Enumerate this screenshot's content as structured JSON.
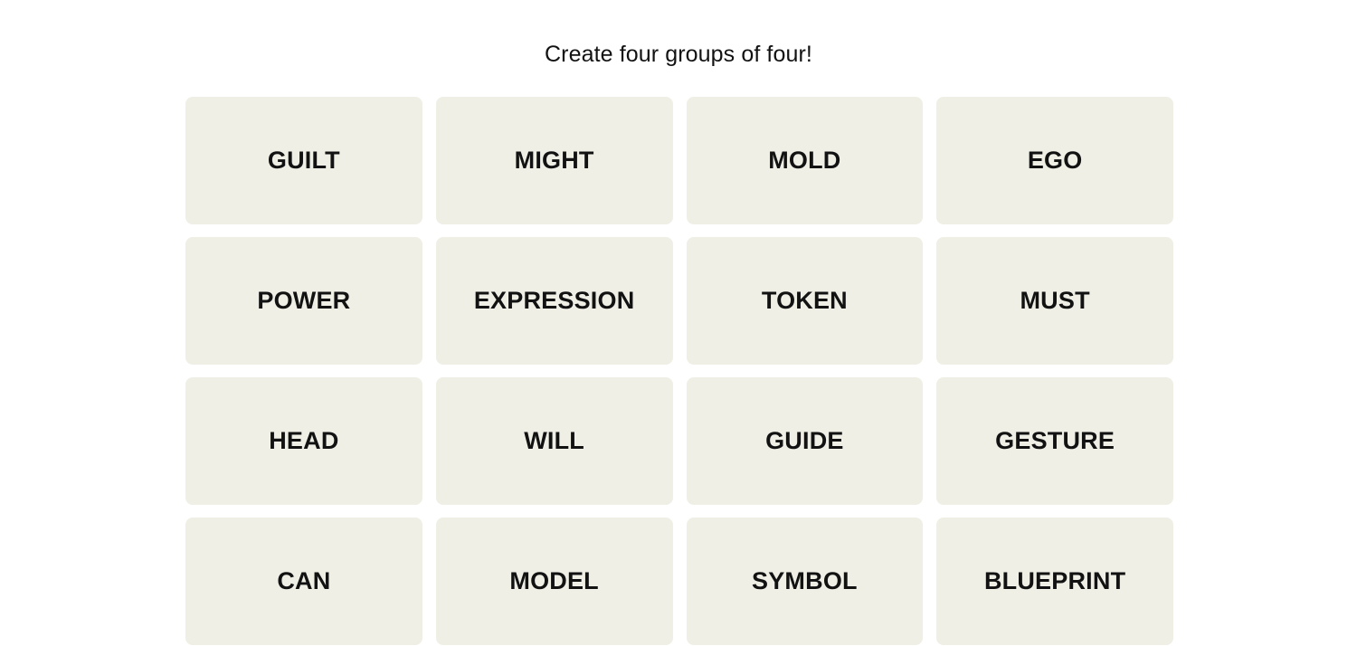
{
  "page": {
    "background_color": "#ffffff"
  },
  "header": {
    "instruction": "Create four groups of four!"
  },
  "board": {
    "columns": 4,
    "rows": 4,
    "tile_color": "#efefe6",
    "tile_text_color": "#121212",
    "tiles": [
      {
        "label": "GUILT",
        "row": 1,
        "col": 1,
        "selected": false
      },
      {
        "label": "MIGHT",
        "row": 1,
        "col": 2,
        "selected": false
      },
      {
        "label": "MOLD",
        "row": 1,
        "col": 3,
        "selected": false
      },
      {
        "label": "EGO",
        "row": 1,
        "col": 4,
        "selected": false
      },
      {
        "label": "POWER",
        "row": 2,
        "col": 1,
        "selected": false
      },
      {
        "label": "EXPRESSION",
        "row": 2,
        "col": 2,
        "selected": false
      },
      {
        "label": "TOKEN",
        "row": 2,
        "col": 3,
        "selected": false
      },
      {
        "label": "MUST",
        "row": 2,
        "col": 4,
        "selected": false
      },
      {
        "label": "HEAD",
        "row": 3,
        "col": 1,
        "selected": false
      },
      {
        "label": "WILL",
        "row": 3,
        "col": 2,
        "selected": false
      },
      {
        "label": "GUIDE",
        "row": 3,
        "col": 3,
        "selected": false
      },
      {
        "label": "GESTURE",
        "row": 3,
        "col": 4,
        "selected": false
      },
      {
        "label": "CAN",
        "row": 4,
        "col": 1,
        "selected": false
      },
      {
        "label": "MODEL",
        "row": 4,
        "col": 2,
        "selected": false
      },
      {
        "label": "SYMBOL",
        "row": 4,
        "col": 3,
        "selected": false
      },
      {
        "label": "BLUEPRINT",
        "row": 4,
        "col": 4,
        "selected": false
      }
    ]
  }
}
